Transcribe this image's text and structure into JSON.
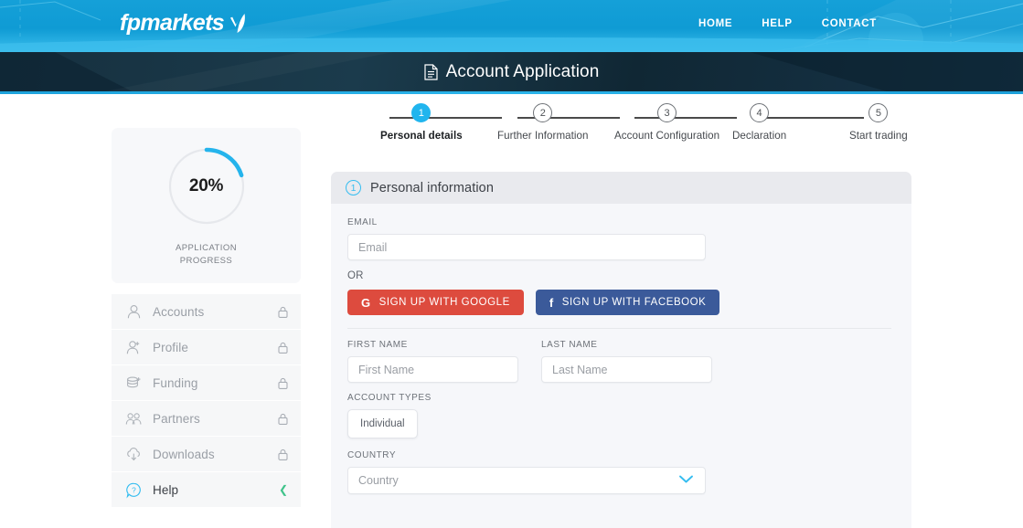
{
  "header": {
    "logo_text": "fpmarkets",
    "logo_icon": "leaf-mark-icon",
    "nav": [
      {
        "label": "HOME"
      },
      {
        "label": "HELP"
      },
      {
        "label": "CONTACT"
      }
    ],
    "brand_color": "#0f9bd4"
  },
  "titlebar": {
    "icon": "document-icon",
    "title": "Account Application",
    "background": "#16303f",
    "accent": "#1ea3dc"
  },
  "progress": {
    "percent_label": "20%",
    "percent_value": 20,
    "caption_line1": "APPLICATION",
    "caption_line2": "PROGRESS",
    "arc_color": "#25b4ec",
    "track_color": "#e6e8ec"
  },
  "sidebar": {
    "items": [
      {
        "label": "Accounts",
        "icon": "user-icon",
        "right_icon": "lock-icon",
        "locked": true,
        "active": false
      },
      {
        "label": "Profile",
        "icon": "user-plus-icon",
        "right_icon": "lock-icon",
        "locked": true,
        "active": false
      },
      {
        "label": "Funding",
        "icon": "coins-icon",
        "right_icon": "lock-icon",
        "locked": true,
        "active": false
      },
      {
        "label": "Partners",
        "icon": "users-icon",
        "right_icon": "lock-icon",
        "locked": true,
        "active": false
      },
      {
        "label": "Downloads",
        "icon": "cloud-down-icon",
        "right_icon": "lock-icon",
        "locked": true,
        "active": false
      },
      {
        "label": "Help",
        "icon": "help-bubble-icon",
        "right_icon": "chevron-left-icon",
        "locked": false,
        "active": true
      }
    ]
  },
  "stepper": {
    "current": 1,
    "steps": [
      {
        "number": "1",
        "label": "Personal details"
      },
      {
        "number": "2",
        "label": "Further Information"
      },
      {
        "number": "3",
        "label": "Account Configuration"
      },
      {
        "number": "4",
        "label": "Declaration"
      },
      {
        "number": "5",
        "label": "Start trading"
      }
    ],
    "active_color": "#21b5ee"
  },
  "panel": {
    "section_number": "1",
    "section_title": "Personal information",
    "email": {
      "label": "EMAIL",
      "placeholder": "Email",
      "value": ""
    },
    "or_text": "OR",
    "social": {
      "google": {
        "label": "SIGN UP WITH GOOGLE",
        "glyph": "G",
        "icon": "google-icon",
        "color": "#dd4b3e"
      },
      "facebook": {
        "label": "SIGN UP WITH FACEBOOK",
        "glyph": "f",
        "icon": "facebook-icon",
        "color": "#3b5a9a"
      }
    },
    "first_name": {
      "label": "FIRST NAME",
      "placeholder": "First Name",
      "value": ""
    },
    "last_name": {
      "label": "LAST NAME",
      "placeholder": "Last Name",
      "value": ""
    },
    "account_types": {
      "label": "ACCOUNT TYPES",
      "options": [
        {
          "label": "Individual",
          "selected": true
        }
      ]
    },
    "country": {
      "label": "COUNTRY",
      "placeholder": "Country",
      "value": "",
      "chevron_icon": "chevron-down-icon",
      "chevron_color": "#35bdf0"
    }
  }
}
